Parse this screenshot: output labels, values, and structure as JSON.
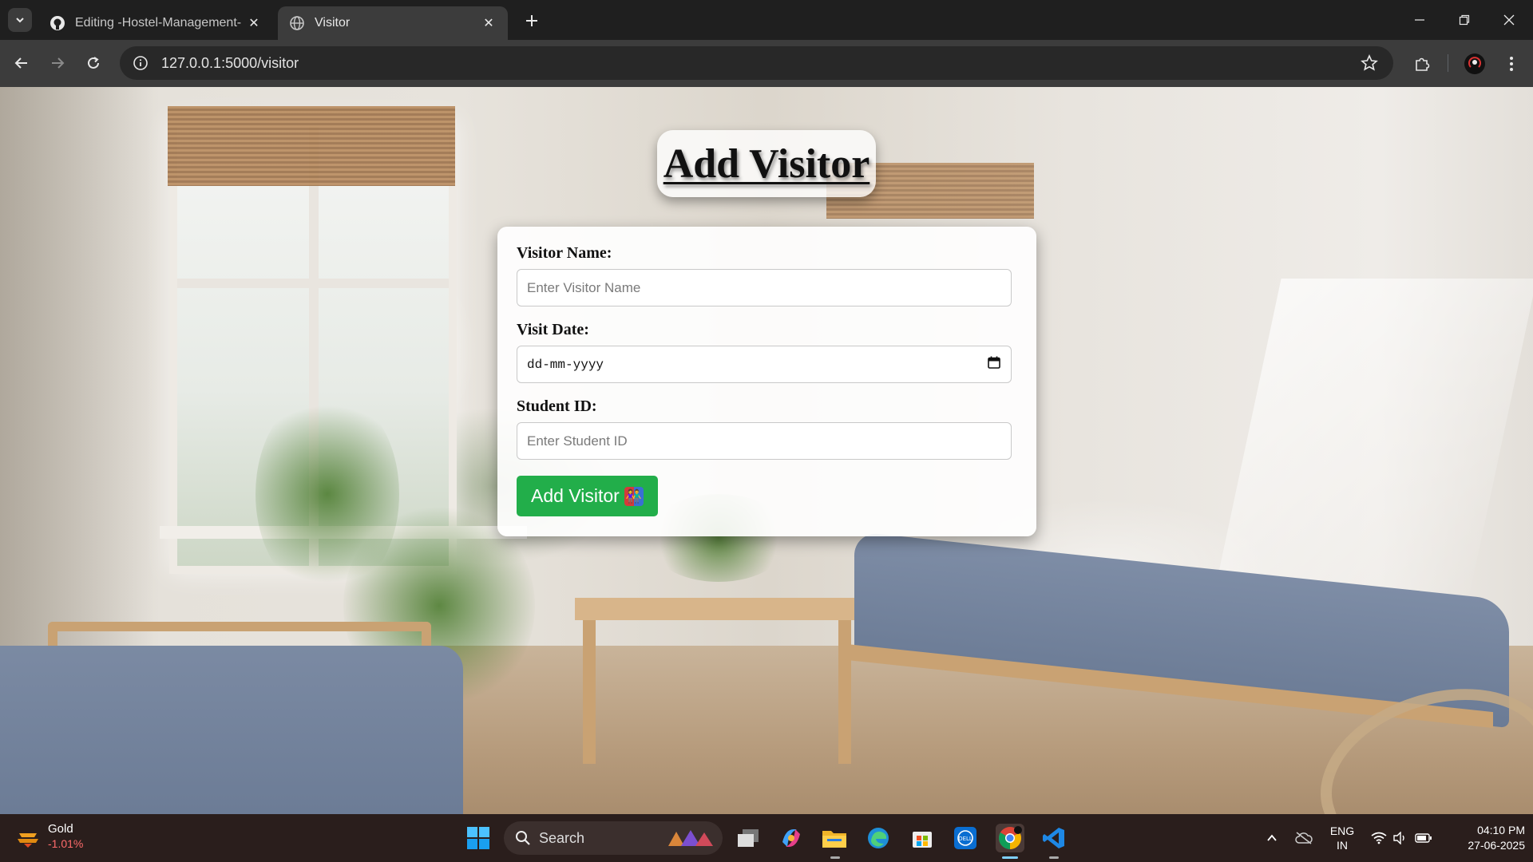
{
  "browser": {
    "tabs": [
      {
        "title": "Editing -Hostel-Management-S",
        "favicon": "github-icon",
        "active": false
      },
      {
        "title": "Visitor",
        "favicon": "globe-icon",
        "active": true
      }
    ],
    "address": "127.0.0.1:5000/visitor"
  },
  "page": {
    "heading": "Add Visitor",
    "form": {
      "visitor_name_label": "Visitor Name:",
      "visitor_name_placeholder": "Enter Visitor Name",
      "visit_date_label": "Visit Date:",
      "visit_date_placeholder": "dd-mm-yyyy",
      "student_id_label": "Student ID:",
      "student_id_placeholder": "Enter Student ID",
      "submit_label": "Add Visitor",
      "submit_emoji": "👫"
    }
  },
  "taskbar": {
    "widget": {
      "name": "Gold",
      "change": "-1.01%"
    },
    "search_label": "Search",
    "language": {
      "line1": "ENG",
      "line2": "IN"
    },
    "time": "04:10 PM",
    "date": "27-06-2025"
  },
  "colors": {
    "submit_button": "#22ae4a",
    "widget_change": "#ff6b6b"
  }
}
